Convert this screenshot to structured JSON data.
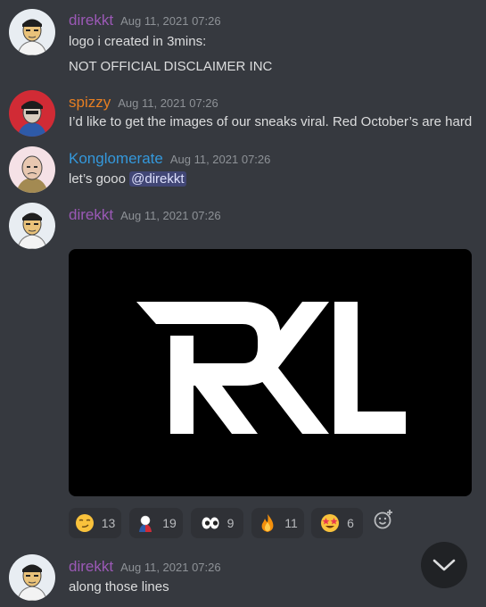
{
  "colors": {
    "background": "#36393f",
    "user_purple": "#9b59b6",
    "user_orange": "#e67e22",
    "user_blue": "#3498db",
    "mention_bg": "#414675"
  },
  "messages": [
    {
      "username": "direkkt",
      "timestamp": "Aug 11, 2021 07:26",
      "lines": [
        "logo i created in 3mins:",
        "NOT OFFICIAL DISCLAIMER INC"
      ]
    },
    {
      "username": "spizzy",
      "timestamp": "Aug 11, 2021 07:26",
      "lines": [
        "I’d like to get the images of our sneaks viral. Red October’s are hard"
      ]
    },
    {
      "username": "Konglomerate",
      "timestamp": "Aug 11, 2021 07:26",
      "text": "let’s gooo",
      "mention": "@direkkt"
    },
    {
      "username": "direkkt",
      "timestamp": "Aug 11, 2021 07:26",
      "attachment": "RKL"
    },
    {
      "username": "direkkt",
      "timestamp": "Aug 11, 2021 07:26",
      "lines": [
        "along those lines"
      ]
    }
  ],
  "reactions": [
    {
      "emoji": "smirk-emoji",
      "count": "13"
    },
    {
      "emoji": "custom-mascot-emoji",
      "count": "19"
    },
    {
      "emoji": "eyes-emoji",
      "count": "9"
    },
    {
      "emoji": "fire-emoji",
      "count": "11"
    },
    {
      "emoji": "star-struck-emoji",
      "count": "6"
    }
  ]
}
